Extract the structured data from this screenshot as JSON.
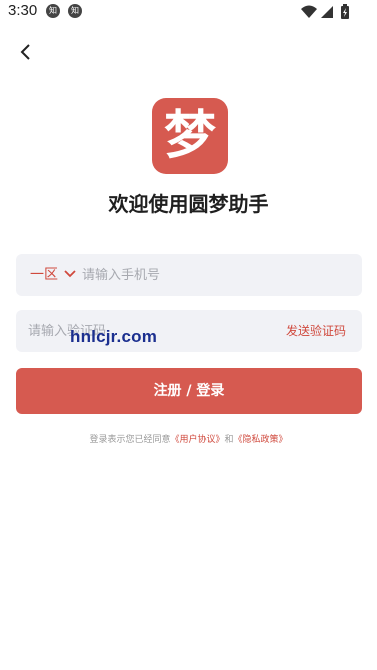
{
  "status_bar": {
    "time": "3:30",
    "notifications": [
      "知",
      "知"
    ],
    "icons": [
      "wifi-icon",
      "cellular-icon",
      "battery-icon"
    ]
  },
  "nav": {
    "back_icon": "chevron-left-icon"
  },
  "logo": {
    "glyph": "梦",
    "color": "#d65a50"
  },
  "title": "欢迎使用圆梦助手",
  "phone": {
    "region": "一区",
    "placeholder": "请输入手机号"
  },
  "code": {
    "placeholder": "请输入验证码",
    "send_label": "发送验证码"
  },
  "watermark": "hnlcjr.com",
  "submit_label": "注册 / 登录",
  "agreement": {
    "prefix": "登录表示您已经同意",
    "user_agreement": "《用户协议》",
    "conjunction": "和",
    "privacy_policy": "《隐私政策》"
  },
  "colors": {
    "accent": "#d65a50",
    "input_bg": "#f1f2f6",
    "link": "#d0493d"
  }
}
